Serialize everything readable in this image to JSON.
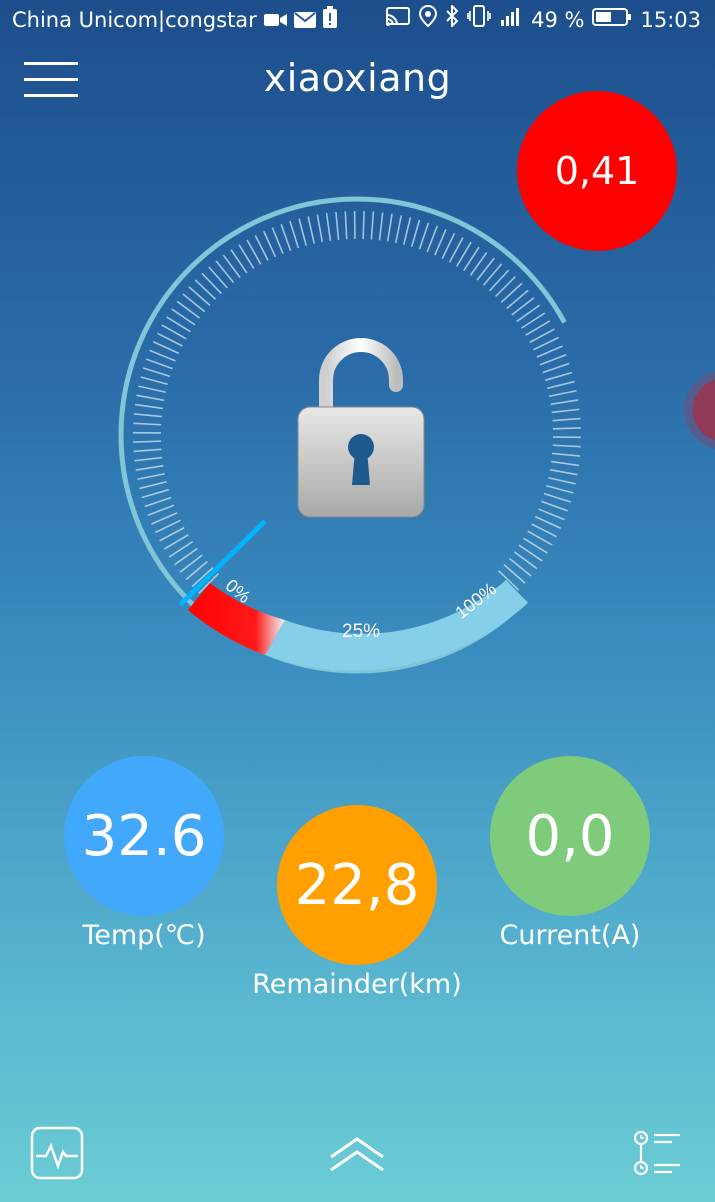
{
  "status_bar": {
    "carrier": "China Unicom|congstar",
    "battery_percent": "49 %",
    "time": "15:03",
    "icons": [
      "video-icon",
      "mail-icon",
      "battery-alert-icon",
      "cast-icon",
      "location-icon",
      "bluetooth-icon",
      "vibrate-icon",
      "signal-icon",
      "battery-icon"
    ]
  },
  "header": {
    "title": "xiaoxiang",
    "menu_icon": "hamburger-menu-icon"
  },
  "voltage_bubble": {
    "value": "0,41",
    "color": "#ff0000"
  },
  "gauge": {
    "lock_state": "unlocked",
    "lock_icon": "unlocked-padlock-icon",
    "labels": {
      "min": "0%",
      "mid": "25%",
      "max": "100%"
    },
    "level_percent": 0
  },
  "metrics": {
    "temp": {
      "value": "32.6",
      "label": "Temp(℃)",
      "color": "#42a8fb"
    },
    "remainder": {
      "value": "22,8",
      "label": "Remainder(km)",
      "color": "#ffa000"
    },
    "current": {
      "value": "0,0",
      "label": "Current(A)",
      "color": "#7ecb7b"
    }
  },
  "bottom_bar": {
    "left_icon": "pulse-chart-icon",
    "center_icon": "chevron-up-icon",
    "right_icon": "history-list-icon"
  }
}
